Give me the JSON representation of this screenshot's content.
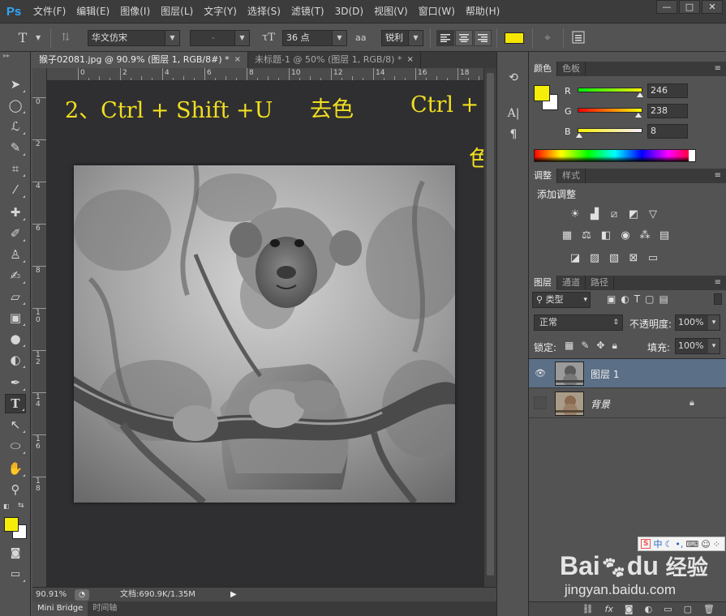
{
  "app": {
    "logo": "Ps"
  },
  "menu": [
    "文件(F)",
    "编辑(E)",
    "图像(I)",
    "图层(L)",
    "文字(Y)",
    "选择(S)",
    "滤镜(T)",
    "3D(D)",
    "视图(V)",
    "窗口(W)",
    "帮助(H)"
  ],
  "window_controls": {
    "minimize": "—",
    "restore": "□",
    "close": "✕"
  },
  "options": {
    "font_family": "华文仿宋",
    "font_style": "-",
    "font_size": "36 点",
    "anti_alias_icon": "aa",
    "anti_alias": "锐利",
    "text_color": "#f5e600"
  },
  "documents": {
    "tabs": [
      {
        "label": "猴子02081.jpg @ 90.9% (图层 1, RGB/8#) *",
        "close": "×",
        "active": true
      },
      {
        "label": "未标题-1 @ 50% (图层 1, RGB/8) *",
        "close": "×",
        "active": false
      }
    ],
    "ruler_top": [
      "0",
      "2",
      "4",
      "6",
      "8",
      "10",
      "12",
      "14",
      "16",
      "18"
    ],
    "ruler_left": [
      "0",
      "2",
      "4",
      "6",
      "8",
      "1\n0",
      "1\n2",
      "1\n4",
      "1\n6",
      "1\n8"
    ]
  },
  "annotation": {
    "line1": "2、Ctrl + Shift +U",
    "line1_cn": "去色",
    "line2": "Ctrl + L",
    "line2_cn": "色阶"
  },
  "status": {
    "zoom": "90.91%",
    "doc_size": "文档:690.9K/1.35M"
  },
  "bottom_tabs": [
    "Mini Bridge",
    "时间轴"
  ],
  "color_panel": {
    "tabs": [
      "颜色",
      "色板"
    ],
    "foreground": "#f6ee08",
    "background": "#ffffff",
    "channels": [
      {
        "label": "R",
        "value": "246",
        "fraction": 0.965
      },
      {
        "label": "G",
        "value": "238",
        "fraction": 0.933
      },
      {
        "label": "B",
        "value": "8",
        "fraction": 0.031
      }
    ]
  },
  "adjustments_panel": {
    "tabs": [
      "调整",
      "样式"
    ],
    "title": "添加调整"
  },
  "layers_panel": {
    "tabs": [
      "图层",
      "通道",
      "路径"
    ],
    "filter_kind": "类型",
    "blend_mode": "正常",
    "opacity_label": "不透明度:",
    "opacity": "100%",
    "lock_label": "锁定:",
    "fill_label": "填充:",
    "fill": "100%",
    "layers": [
      {
        "name": "图层 1",
        "visible": true,
        "selected": true
      },
      {
        "name": "背景",
        "visible": false,
        "selected": false
      }
    ],
    "footer_icons": [
      "link-icon",
      "fx-icon",
      "mask-icon",
      "adjustment-icon",
      "group-icon",
      "new-layer-icon",
      "trash-icon"
    ],
    "footer_fx": "fx"
  },
  "watermark": {
    "ime_label": "中",
    "brand_latin": "Bai",
    "brand_du": "du",
    "brand_cn": "经验",
    "url": "jingyan.baidu.com"
  }
}
